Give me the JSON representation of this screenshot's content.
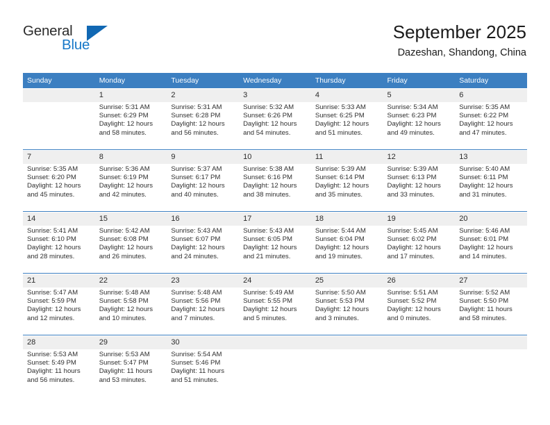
{
  "brand": {
    "name_part1": "General",
    "name_part2": "Blue",
    "triangle_icon": "brand-triangle-icon"
  },
  "header": {
    "title": "September 2025",
    "subtitle": "Dazeshan, Shandong, China"
  },
  "colors": {
    "header_blue": "#3c7fc1",
    "grid_line_blue": "#3c7fc1",
    "daynum_bg": "#efefef",
    "brand_blue": "#1878c8",
    "triangle_blue": "#1168b3",
    "text": "#2e2e2e"
  },
  "calendar": {
    "weekday_headers": [
      "Sunday",
      "Monday",
      "Tuesday",
      "Wednesday",
      "Thursday",
      "Friday",
      "Saturday"
    ],
    "weeks": [
      [
        {
          "day": "",
          "blank": true,
          "sunrise": "",
          "sunset": "",
          "daylight_line1": "",
          "daylight_line2": ""
        },
        {
          "day": "1",
          "sunrise": "Sunrise: 5:31 AM",
          "sunset": "Sunset: 6:29 PM",
          "daylight_line1": "Daylight: 12 hours",
          "daylight_line2": "and 58 minutes."
        },
        {
          "day": "2",
          "sunrise": "Sunrise: 5:31 AM",
          "sunset": "Sunset: 6:28 PM",
          "daylight_line1": "Daylight: 12 hours",
          "daylight_line2": "and 56 minutes."
        },
        {
          "day": "3",
          "sunrise": "Sunrise: 5:32 AM",
          "sunset": "Sunset: 6:26 PM",
          "daylight_line1": "Daylight: 12 hours",
          "daylight_line2": "and 54 minutes."
        },
        {
          "day": "4",
          "sunrise": "Sunrise: 5:33 AM",
          "sunset": "Sunset: 6:25 PM",
          "daylight_line1": "Daylight: 12 hours",
          "daylight_line2": "and 51 minutes."
        },
        {
          "day": "5",
          "sunrise": "Sunrise: 5:34 AM",
          "sunset": "Sunset: 6:23 PM",
          "daylight_line1": "Daylight: 12 hours",
          "daylight_line2": "and 49 minutes."
        },
        {
          "day": "6",
          "sunrise": "Sunrise: 5:35 AM",
          "sunset": "Sunset: 6:22 PM",
          "daylight_line1": "Daylight: 12 hours",
          "daylight_line2": "and 47 minutes."
        }
      ],
      [
        {
          "day": "7",
          "sunrise": "Sunrise: 5:35 AM",
          "sunset": "Sunset: 6:20 PM",
          "daylight_line1": "Daylight: 12 hours",
          "daylight_line2": "and 45 minutes."
        },
        {
          "day": "8",
          "sunrise": "Sunrise: 5:36 AM",
          "sunset": "Sunset: 6:19 PM",
          "daylight_line1": "Daylight: 12 hours",
          "daylight_line2": "and 42 minutes."
        },
        {
          "day": "9",
          "sunrise": "Sunrise: 5:37 AM",
          "sunset": "Sunset: 6:17 PM",
          "daylight_line1": "Daylight: 12 hours",
          "daylight_line2": "and 40 minutes."
        },
        {
          "day": "10",
          "sunrise": "Sunrise: 5:38 AM",
          "sunset": "Sunset: 6:16 PM",
          "daylight_line1": "Daylight: 12 hours",
          "daylight_line2": "and 38 minutes."
        },
        {
          "day": "11",
          "sunrise": "Sunrise: 5:39 AM",
          "sunset": "Sunset: 6:14 PM",
          "daylight_line1": "Daylight: 12 hours",
          "daylight_line2": "and 35 minutes."
        },
        {
          "day": "12",
          "sunrise": "Sunrise: 5:39 AM",
          "sunset": "Sunset: 6:13 PM",
          "daylight_line1": "Daylight: 12 hours",
          "daylight_line2": "and 33 minutes."
        },
        {
          "day": "13",
          "sunrise": "Sunrise: 5:40 AM",
          "sunset": "Sunset: 6:11 PM",
          "daylight_line1": "Daylight: 12 hours",
          "daylight_line2": "and 31 minutes."
        }
      ],
      [
        {
          "day": "14",
          "sunrise": "Sunrise: 5:41 AM",
          "sunset": "Sunset: 6:10 PM",
          "daylight_line1": "Daylight: 12 hours",
          "daylight_line2": "and 28 minutes."
        },
        {
          "day": "15",
          "sunrise": "Sunrise: 5:42 AM",
          "sunset": "Sunset: 6:08 PM",
          "daylight_line1": "Daylight: 12 hours",
          "daylight_line2": "and 26 minutes."
        },
        {
          "day": "16",
          "sunrise": "Sunrise: 5:43 AM",
          "sunset": "Sunset: 6:07 PM",
          "daylight_line1": "Daylight: 12 hours",
          "daylight_line2": "and 24 minutes."
        },
        {
          "day": "17",
          "sunrise": "Sunrise: 5:43 AM",
          "sunset": "Sunset: 6:05 PM",
          "daylight_line1": "Daylight: 12 hours",
          "daylight_line2": "and 21 minutes."
        },
        {
          "day": "18",
          "sunrise": "Sunrise: 5:44 AM",
          "sunset": "Sunset: 6:04 PM",
          "daylight_line1": "Daylight: 12 hours",
          "daylight_line2": "and 19 minutes."
        },
        {
          "day": "19",
          "sunrise": "Sunrise: 5:45 AM",
          "sunset": "Sunset: 6:02 PM",
          "daylight_line1": "Daylight: 12 hours",
          "daylight_line2": "and 17 minutes."
        },
        {
          "day": "20",
          "sunrise": "Sunrise: 5:46 AM",
          "sunset": "Sunset: 6:01 PM",
          "daylight_line1": "Daylight: 12 hours",
          "daylight_line2": "and 14 minutes."
        }
      ],
      [
        {
          "day": "21",
          "sunrise": "Sunrise: 5:47 AM",
          "sunset": "Sunset: 5:59 PM",
          "daylight_line1": "Daylight: 12 hours",
          "daylight_line2": "and 12 minutes."
        },
        {
          "day": "22",
          "sunrise": "Sunrise: 5:48 AM",
          "sunset": "Sunset: 5:58 PM",
          "daylight_line1": "Daylight: 12 hours",
          "daylight_line2": "and 10 minutes."
        },
        {
          "day": "23",
          "sunrise": "Sunrise: 5:48 AM",
          "sunset": "Sunset: 5:56 PM",
          "daylight_line1": "Daylight: 12 hours",
          "daylight_line2": "and 7 minutes."
        },
        {
          "day": "24",
          "sunrise": "Sunrise: 5:49 AM",
          "sunset": "Sunset: 5:55 PM",
          "daylight_line1": "Daylight: 12 hours",
          "daylight_line2": "and 5 minutes."
        },
        {
          "day": "25",
          "sunrise": "Sunrise: 5:50 AM",
          "sunset": "Sunset: 5:53 PM",
          "daylight_line1": "Daylight: 12 hours",
          "daylight_line2": "and 3 minutes."
        },
        {
          "day": "26",
          "sunrise": "Sunrise: 5:51 AM",
          "sunset": "Sunset: 5:52 PM",
          "daylight_line1": "Daylight: 12 hours",
          "daylight_line2": "and 0 minutes."
        },
        {
          "day": "27",
          "sunrise": "Sunrise: 5:52 AM",
          "sunset": "Sunset: 5:50 PM",
          "daylight_line1": "Daylight: 11 hours",
          "daylight_line2": "and 58 minutes."
        }
      ],
      [
        {
          "day": "28",
          "sunrise": "Sunrise: 5:53 AM",
          "sunset": "Sunset: 5:49 PM",
          "daylight_line1": "Daylight: 11 hours",
          "daylight_line2": "and 56 minutes."
        },
        {
          "day": "29",
          "sunrise": "Sunrise: 5:53 AM",
          "sunset": "Sunset: 5:47 PM",
          "daylight_line1": "Daylight: 11 hours",
          "daylight_line2": "and 53 minutes."
        },
        {
          "day": "30",
          "sunrise": "Sunrise: 5:54 AM",
          "sunset": "Sunset: 5:46 PM",
          "daylight_line1": "Daylight: 11 hours",
          "daylight_line2": "and 51 minutes."
        },
        {
          "day": "",
          "blank": true,
          "sunrise": "",
          "sunset": "",
          "daylight_line1": "",
          "daylight_line2": ""
        },
        {
          "day": "",
          "blank": true,
          "sunrise": "",
          "sunset": "",
          "daylight_line1": "",
          "daylight_line2": ""
        },
        {
          "day": "",
          "blank": true,
          "sunrise": "",
          "sunset": "",
          "daylight_line1": "",
          "daylight_line2": ""
        },
        {
          "day": "",
          "blank": true,
          "sunrise": "",
          "sunset": "",
          "daylight_line1": "",
          "daylight_line2": ""
        }
      ]
    ]
  }
}
